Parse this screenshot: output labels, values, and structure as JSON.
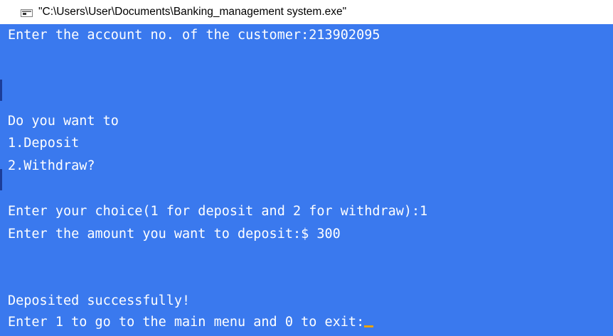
{
  "window": {
    "title": "\"C:\\Users\\User\\Documents\\Banking_management system.exe\"",
    "icon": "console-window-icon"
  },
  "console": {
    "background": "#3a79ee",
    "text_color": "#ffffff",
    "cursor_color": "#e8a200",
    "lines": [
      "Enter the account no. of the customer:213902095",
      "",
      "",
      "Do you want to",
      "1.Deposit",
      "2.Withdraw?",
      "",
      "Enter your choice(1 for deposit and 2 for withdraw):1",
      "Enter the amount you want to deposit:$ 300",
      "",
      "",
      "Deposited successfully!",
      "Enter 1 to go to the main menu and 0 to exit:"
    ]
  }
}
